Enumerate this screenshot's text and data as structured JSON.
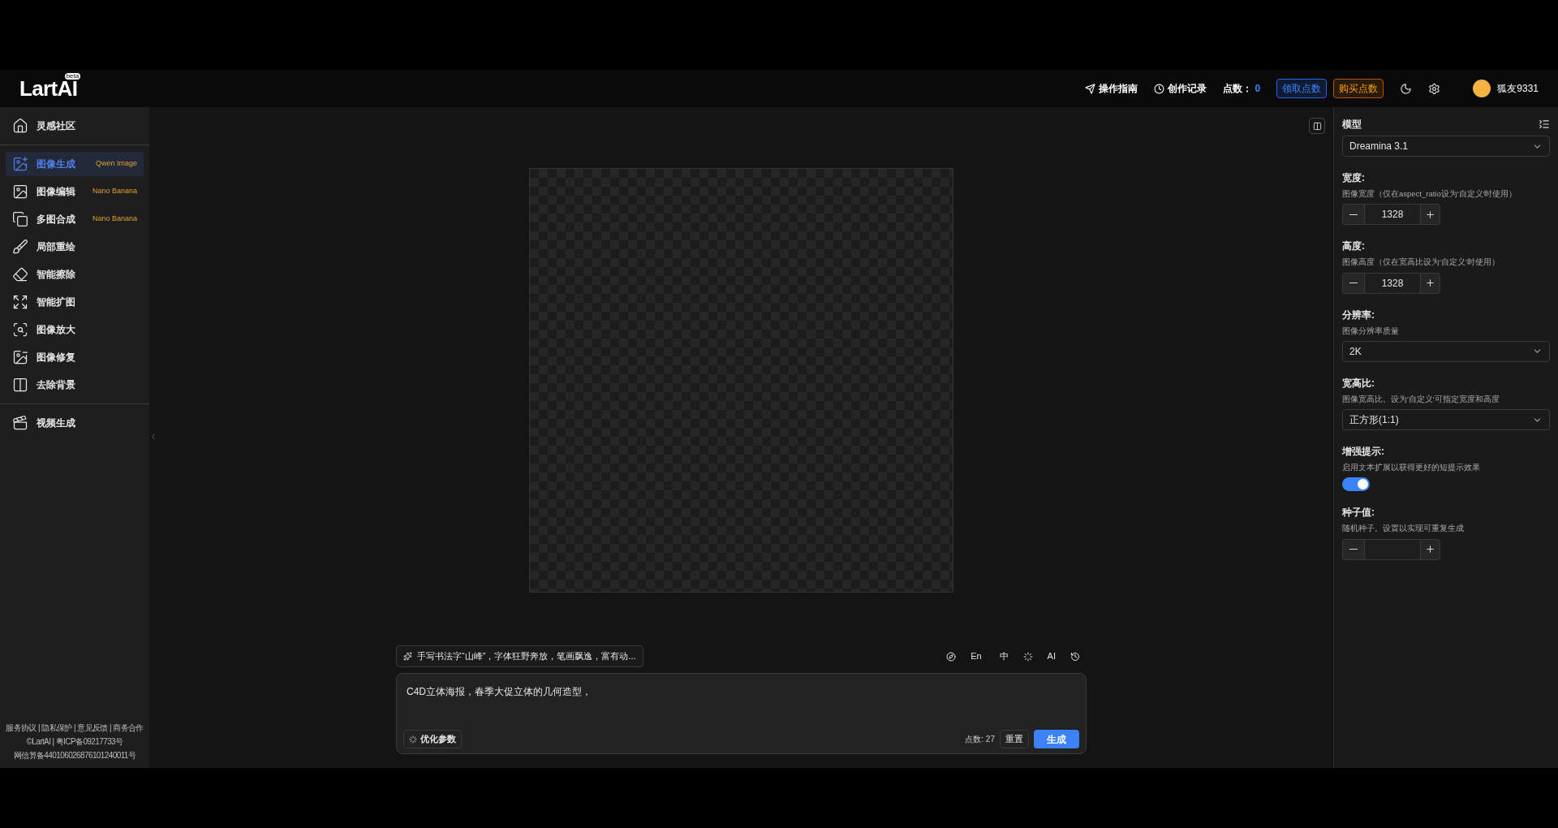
{
  "header": {
    "logo": "LartAI",
    "logo_badge": "beta",
    "nav": [
      {
        "kind": "send",
        "label": "操作指南"
      },
      {
        "kind": "clock",
        "label": "创作记录"
      }
    ],
    "points_label": "点数：",
    "points_value": "0",
    "claim_button": "领取点数",
    "buy_button": "购买点数",
    "username": "狐友9331"
  },
  "sidebar": {
    "sections": [
      [
        {
          "label": "灵感社区",
          "selected": false
        }
      ],
      [
        {
          "label": "图像生成",
          "badge": "Qwen Image",
          "selected": true
        },
        {
          "label": "图像编辑",
          "badge": "Nano Banana",
          "selected": false
        },
        {
          "label": "多图合成",
          "badge": "Nano Banana",
          "selected": false
        },
        {
          "label": "局部重绘",
          "selected": false
        },
        {
          "label": "智能擦除",
          "selected": false
        },
        {
          "label": "智能扩图",
          "selected": false
        },
        {
          "label": "图像放大",
          "selected": false
        },
        {
          "label": "图像修复",
          "selected": false
        },
        {
          "label": "去除背景",
          "selected": false
        }
      ],
      [
        {
          "label": "视频生成",
          "selected": false
        }
      ]
    ],
    "footer": [
      "服务协议 | 隐私保护 | 意见反馈 | 商务合作",
      "©LartAI | 粤ICP备09217733号",
      "网信算备440106026876101240011号"
    ]
  },
  "prompt": {
    "suggestion": "手写书法字“山峰”，字体狂野奔放，笔画飘逸，富有动...",
    "tools": [
      {
        "kind": "compass"
      },
      {
        "kind": "text",
        "label": "En"
      },
      {
        "kind": "text",
        "label": "中"
      },
      {
        "kind": "sparkle"
      },
      {
        "kind": "text",
        "label": "AI"
      },
      {
        "kind": "history"
      }
    ],
    "value": "C4D立体海报，春季大促立体的几何造型，",
    "optimize_button": "优化参数",
    "cost": "点数: 27",
    "reset_button": "重置",
    "generate_button": "生成"
  },
  "settings": [
    {
      "kind": "select",
      "label": "模型",
      "value": "Dreamina 3.1"
    },
    {
      "kind": "stepper",
      "label": "宽度:",
      "description": "图像宽度（仅在aspect_ratio设为'自定义'时使用）",
      "value": "1328"
    },
    {
      "kind": "stepper",
      "label": "高度:",
      "description": "图像高度（仅在宽高比设为'自定义'时使用）",
      "value": "1328"
    },
    {
      "kind": "select",
      "label": "分辨率:",
      "description": "图像分辨率质量",
      "value": "2K"
    },
    {
      "kind": "select",
      "label": "宽高比:",
      "description": "图像宽高比。设为'自定义'可指定宽度和高度",
      "value": "正方形(1:1)"
    },
    {
      "kind": "toggle",
      "label": "增强提示:",
      "description": "启用文本扩展以获得更好的短提示效果",
      "on": true
    },
    {
      "kind": "stepper",
      "label": "种子值:",
      "description": "随机种子。设置以实现可重复生成"
    }
  ]
}
